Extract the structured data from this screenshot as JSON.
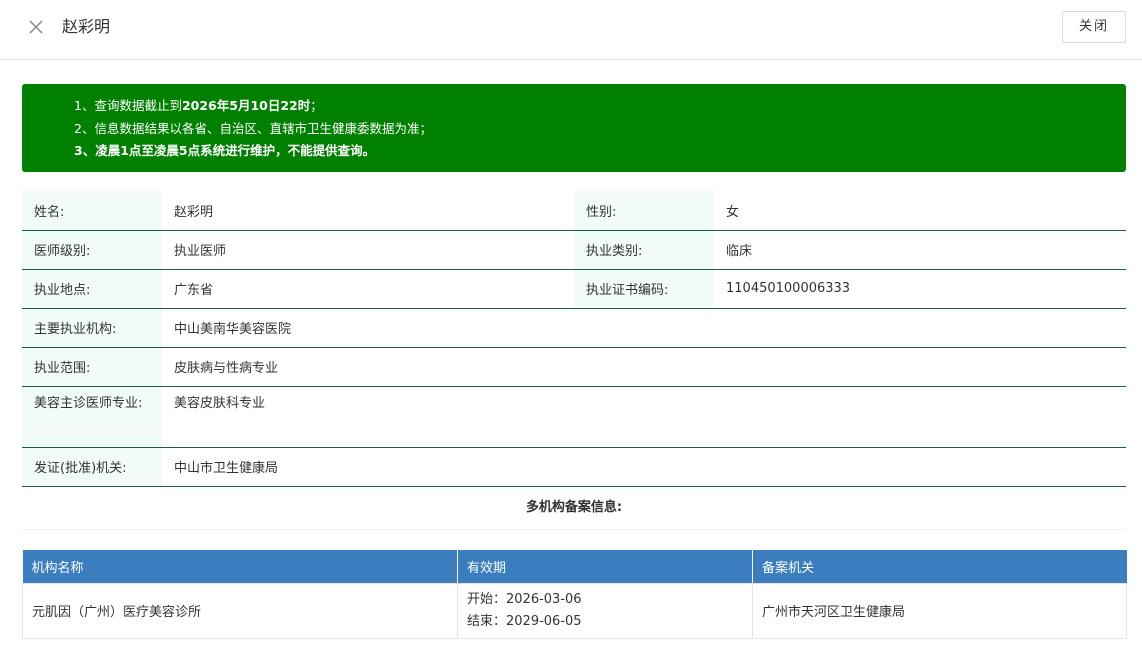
{
  "header": {
    "title": "赵彩明",
    "close_button": "关闭",
    "close_icon": "close-icon"
  },
  "notice": {
    "line1_prefix": "1、查询数据截止到",
    "line1_bold": "2026年5月10日22时",
    "line1_suffix": "；",
    "line2": "2、信息数据结果以各省、自治区、直辖市卫生健康委数据为准；",
    "line3_prefix": "3、",
    "line3_bold": "凌晨1点至凌晨5点",
    "line3_suffix": "系统进行维护，不能提供查询。",
    "background": "#008000"
  },
  "info": {
    "name_label": "姓名:",
    "name_value": "赵彩明",
    "gender_label": "性别:",
    "gender_value": "女",
    "level_label": "医师级别:",
    "level_value": "执业医师",
    "category_label": "执业类别:",
    "category_value": "临床",
    "location_label": "执业地点:",
    "location_value": "广东省",
    "cert_label": "执业证书编码:",
    "cert_value": "110450100006333",
    "institution_label": "主要执业机构:",
    "institution_value": "中山美南华美容医院",
    "scope_label": "执业范围:",
    "scope_value": "皮肤病与性病专业",
    "cosmetic_label": "美容主诊医师专业:",
    "cosmetic_value": "美容皮肤科专业",
    "issuer_label": "发证(批准)机关:",
    "issuer_value": "中山市卫生健康局"
  },
  "multi": {
    "title": "多机构备案信息:",
    "headers": [
      "机构名称",
      "有效期",
      "备案机关"
    ],
    "rows": [
      {
        "name": "元肌因（广州）医疗美容诊所",
        "start": "开始：2026-03-06",
        "end": "结束：2029-06-05",
        "authority": "广州市天河区卫生健康局"
      }
    ],
    "header_color": "#3a7ebf"
  }
}
